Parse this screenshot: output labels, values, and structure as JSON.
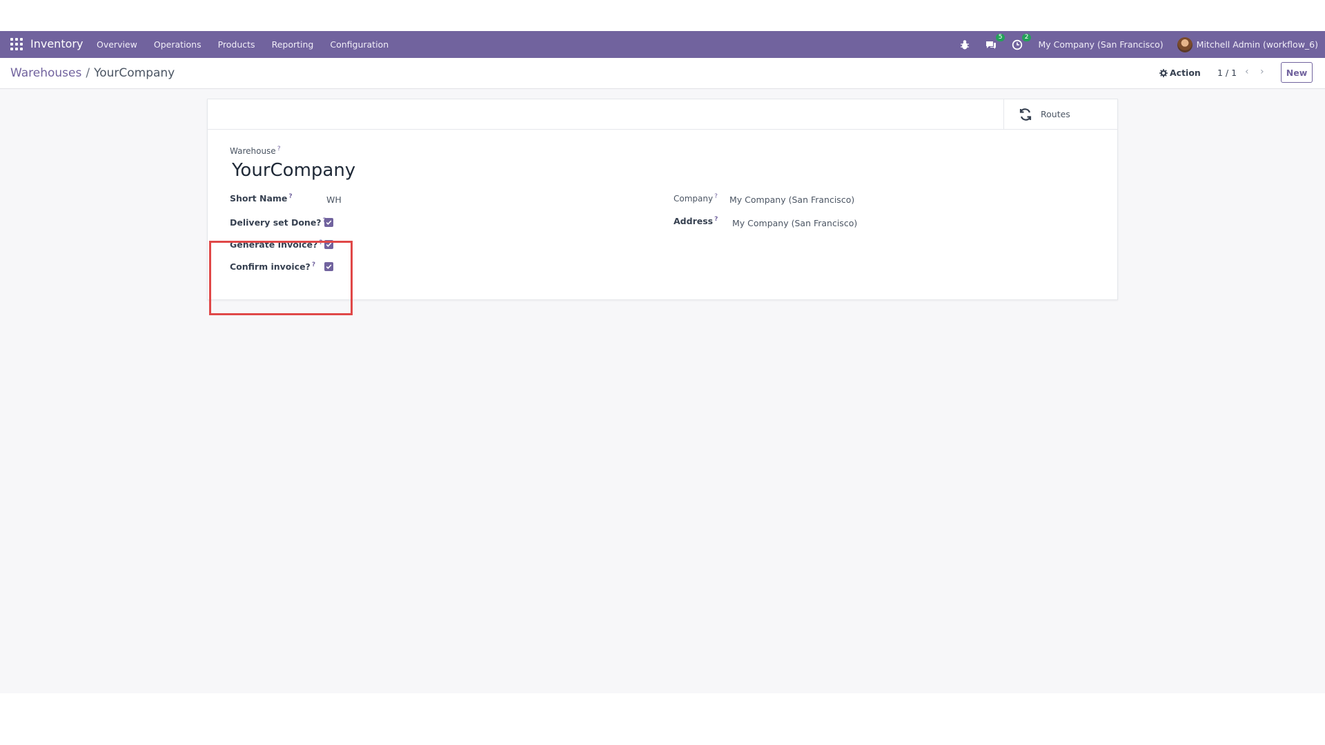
{
  "navbar": {
    "brand": "Inventory",
    "menu": [
      "Overview",
      "Operations",
      "Products",
      "Reporting",
      "Configuration"
    ],
    "messages_badge": "5",
    "activities_badge": "2",
    "company": "My Company (San Francisco)",
    "user": "Mitchell Admin (workflow_6)"
  },
  "breadcrumb": {
    "parent": "Warehouses",
    "separator": "/",
    "current": "YourCompany"
  },
  "control": {
    "action_label": "Action",
    "pager": "1 / 1",
    "new_label": "New"
  },
  "form": {
    "routes_label": "Routes",
    "warehouse_label": "Warehouse",
    "warehouse_name": "YourCompany",
    "help_mark": "?",
    "short_name_label": "Short Name",
    "short_name_value": "WH",
    "delivery_label": "Delivery set Done?",
    "delivery_checked": true,
    "generate_label": "Generate Invoice?",
    "generate_checked": true,
    "confirm_label": "Confirm invoice?",
    "confirm_checked": true,
    "company_label": "Company",
    "company_value": "My Company (San Francisco)",
    "address_label": "Address",
    "address_value": "My Company (San Francisco)"
  },
  "colors": {
    "navbar": "#71639e",
    "accent": "#71639e",
    "badge": "#24a159",
    "highlight": "#e04848"
  }
}
